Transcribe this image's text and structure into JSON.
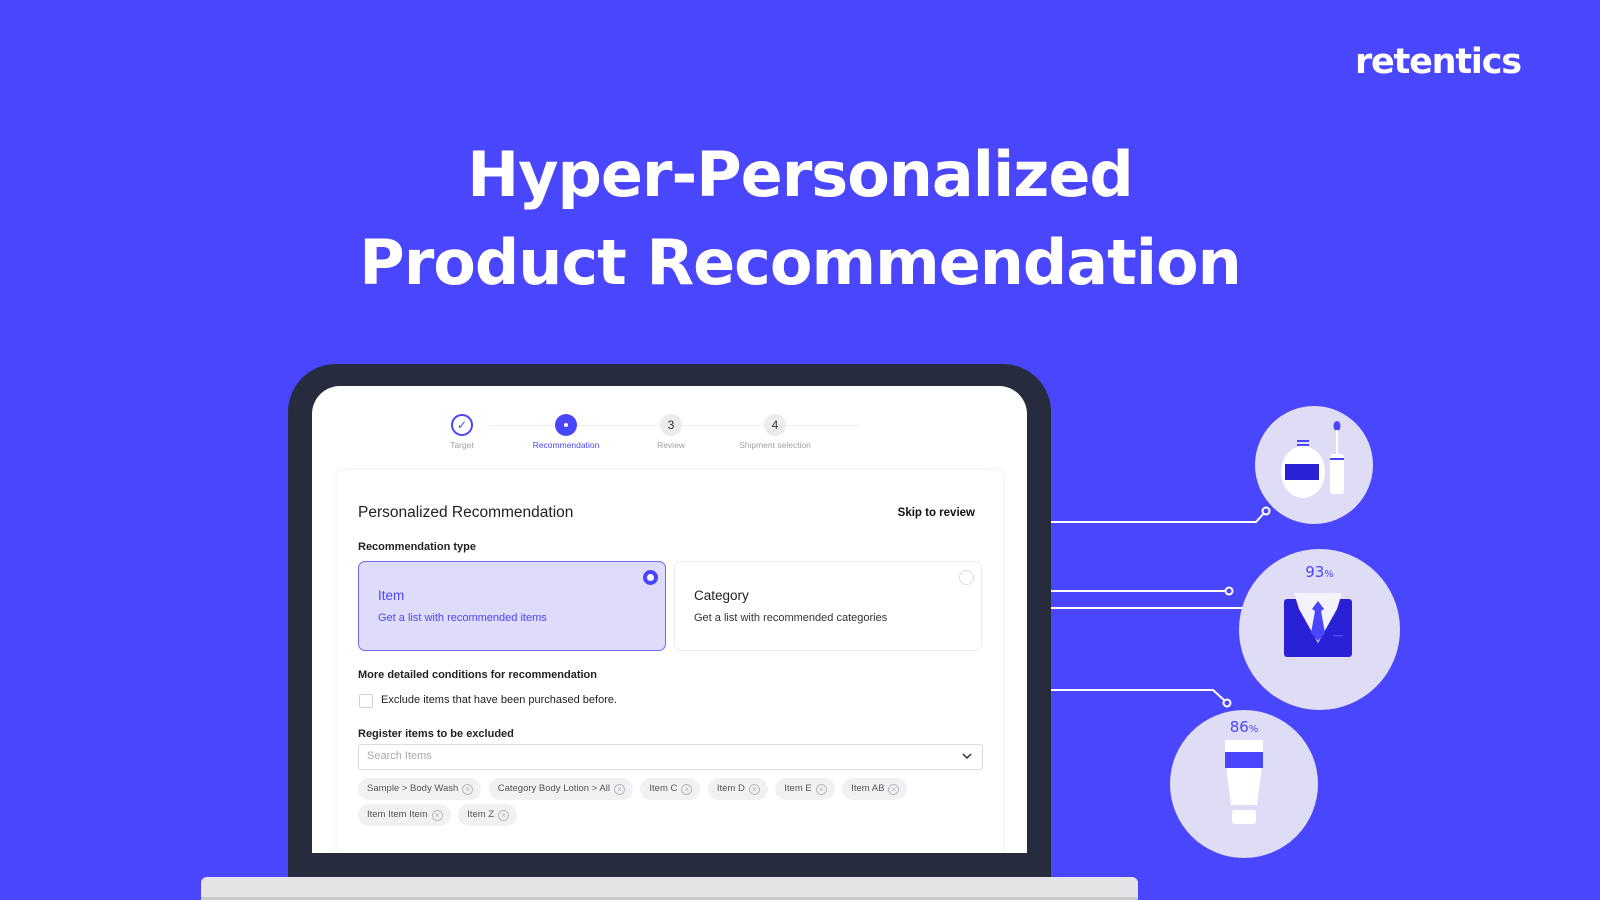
{
  "brand": {
    "logo_text": "retentics",
    "primary_color": "#4a46fe",
    "device_color": "#262c3d",
    "bubble_color": "#dfddf6"
  },
  "headline": {
    "line1": "Hyper-Personalized",
    "line2": "Product Recommendation"
  },
  "stepper": {
    "steps": [
      {
        "label": "Target",
        "state": "done",
        "marker": "✓"
      },
      {
        "label": "Recommendation",
        "state": "active",
        "marker": ""
      },
      {
        "label": "Review",
        "state": "todo",
        "marker": "3"
      },
      {
        "label": "Shipment selection",
        "state": "todo",
        "marker": "4"
      }
    ]
  },
  "form": {
    "title": "Personalized Recommendation",
    "skip_label": "Skip to review",
    "recommendation_type_label": "Recommendation type",
    "options": [
      {
        "title": "Item",
        "description": "Get a list with recommended items",
        "selected": true
      },
      {
        "title": "Category",
        "description": "Get a list with recommended categories",
        "selected": false
      }
    ],
    "conditions_label": "More detailed conditions for recommendation",
    "exclude_purchased": {
      "label": "Exclude items that have been purchased before.",
      "checked": false
    },
    "excluded_label": "Register items to be excluded",
    "search": {
      "placeholder": "Search Items",
      "value": ""
    },
    "tags": [
      "Sample > Body Wash",
      "Category Body Lotion > All",
      "Item C",
      "Item D",
      "Item E",
      "Item AB",
      "Item Item Item",
      "Item Z"
    ]
  },
  "illustrations": [
    {
      "name": "cosmetics",
      "percent": null
    },
    {
      "name": "suit",
      "percent": "93",
      "unit": "%"
    },
    {
      "name": "lotion-tube",
      "percent": "86",
      "unit": "%"
    }
  ]
}
